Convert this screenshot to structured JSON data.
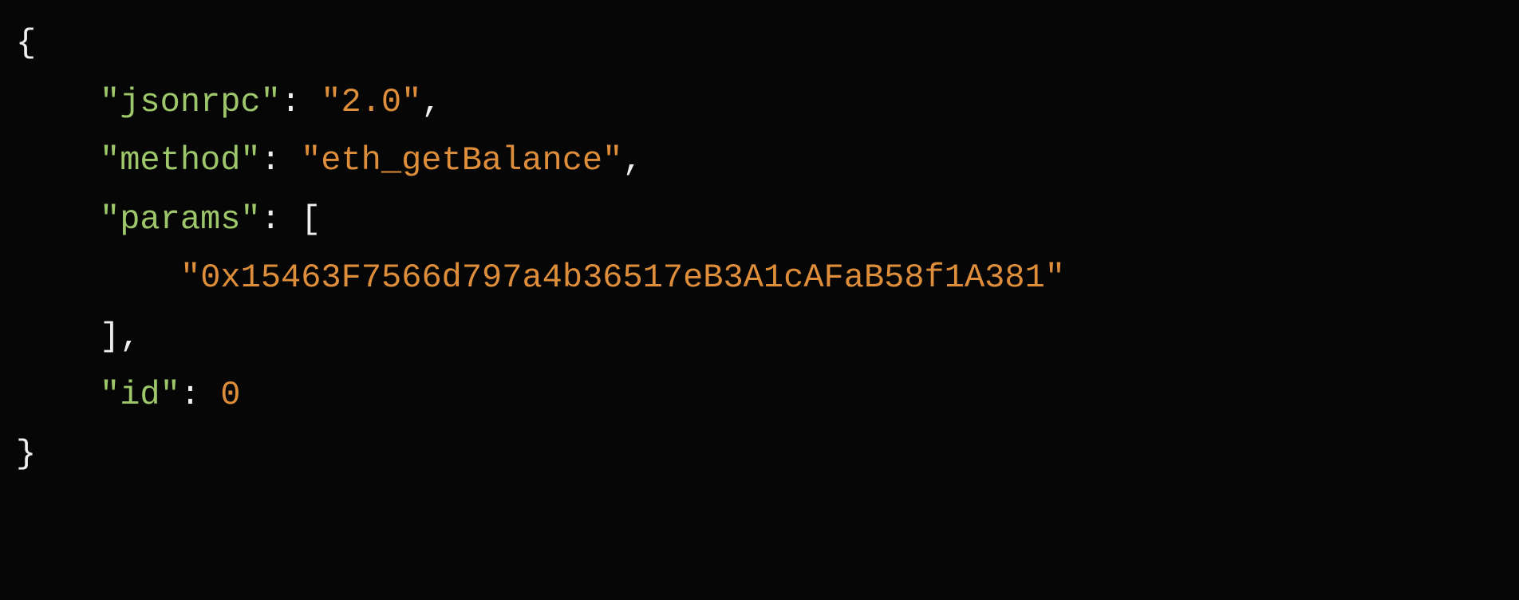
{
  "code": {
    "open_brace": "{",
    "line1": {
      "key": "\"jsonrpc\"",
      "colon": ": ",
      "value": "\"2.0\"",
      "comma": ","
    },
    "line2": {
      "key": "\"method\"",
      "colon": ": ",
      "value": "\"eth_getBalance\"",
      "comma": ","
    },
    "line3": {
      "key": "\"params\"",
      "colon": ": ",
      "bracket": "["
    },
    "line4": {
      "value": "\"0x15463F7566d797a4b36517eB3A1cAFaB58f1A381\""
    },
    "line5": {
      "bracket": "]",
      "comma": ","
    },
    "line6": {
      "key": "\"id\"",
      "colon": ": ",
      "value": "0"
    },
    "close_brace": "}"
  }
}
